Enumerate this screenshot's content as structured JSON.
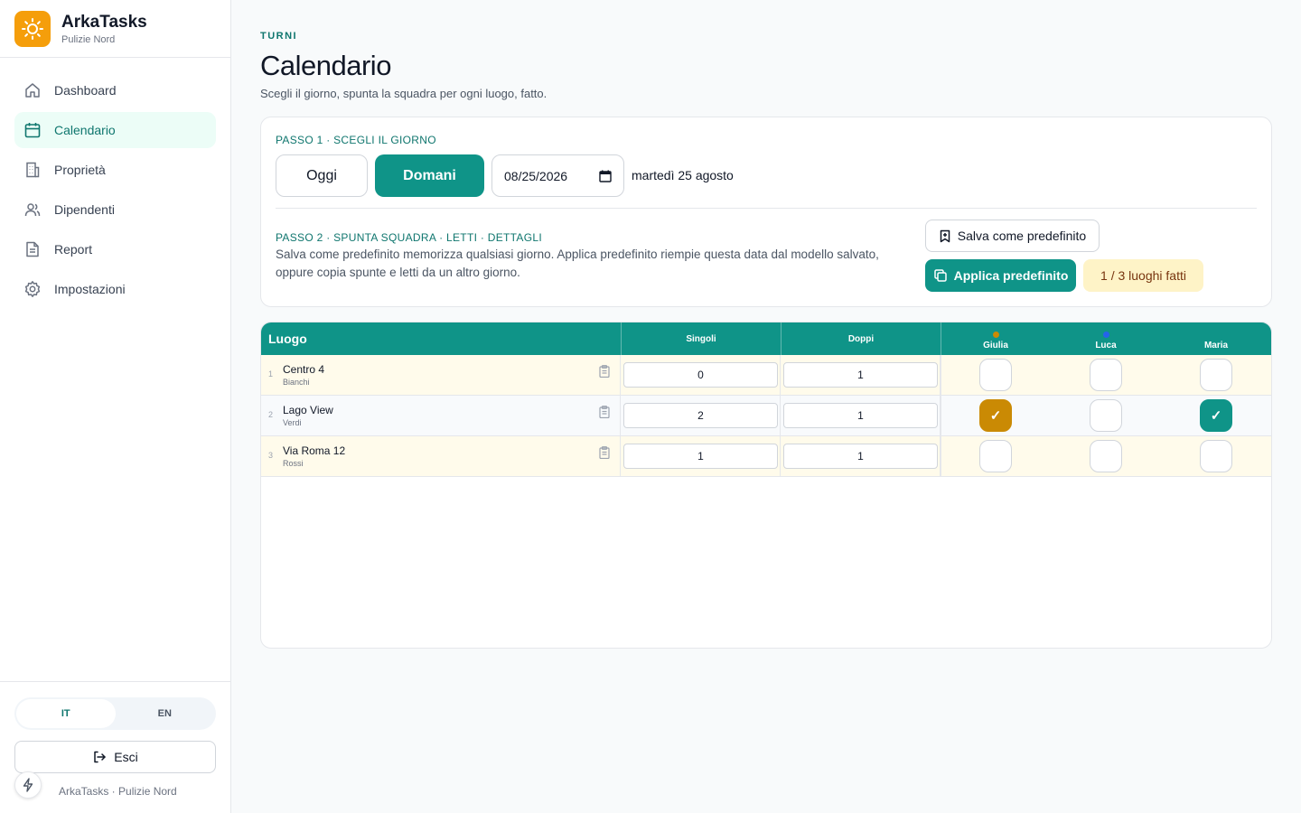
{
  "brand": {
    "name": "ArkaTasks",
    "subtitle": "Pulizie Nord",
    "logo_icon": "sun-icon",
    "logo_color": "#f59e0b"
  },
  "nav": [
    {
      "label": "Dashboard",
      "icon": "home-icon",
      "active": false
    },
    {
      "label": "Calendario",
      "icon": "calendar-icon",
      "active": true
    },
    {
      "label": "Proprietà",
      "icon": "building-icon",
      "active": false
    },
    {
      "label": "Dipendenti",
      "icon": "users-icon",
      "active": false
    },
    {
      "label": "Report",
      "icon": "document-icon",
      "active": false
    },
    {
      "label": "Impostazioni",
      "icon": "gear-icon",
      "active": false
    }
  ],
  "language": {
    "options": [
      "IT",
      "EN"
    ],
    "selected": "IT"
  },
  "logout_label": "Esci",
  "footer": "ArkaTasks · Pulizie Nord",
  "page": {
    "eyebrow": "TURNI",
    "title": "Calendario",
    "description": "Scegli il giorno, spunta la squadra per ogni luogo, fatto."
  },
  "step1": {
    "label": "PASSO 1 · SCEGLI IL GIORNO",
    "today_label": "Oggi",
    "tomorrow_label": "Domani",
    "selected": "Domani",
    "date_value": "08/25/2026",
    "date_text": "martedì 25 agosto"
  },
  "step2": {
    "label": "PASSO 2 · SPUNTA SQUADRA · LETTI · DETTAGLI",
    "description": "Salva come predefinito memorizza qualsiasi giorno. Applica predefinito riempie questa data dal modello salvato, oppure copia spunte e letti da un altro giorno.",
    "save_label": "Salva come predefinito",
    "apply_label": "Applica predefinito",
    "progress": "1 / 3 luoghi fatti"
  },
  "accent": "#0f9488",
  "table": {
    "headers": {
      "luogo": "Luogo",
      "singoli": "Singoli",
      "doppi": "Doppi"
    },
    "people": [
      {
        "name": "Giulia",
        "color": "#ca8a04"
      },
      {
        "name": "Luca",
        "color": "#2563eb"
      },
      {
        "name": "Maria",
        "color": "#0f9488"
      }
    ],
    "rows": [
      {
        "index": "1",
        "name": "Centro 4",
        "owner": "Bianchi",
        "singoli": "0",
        "doppi": "1",
        "checks": [
          false,
          false,
          false
        ]
      },
      {
        "index": "2",
        "name": "Lago View",
        "owner": "Verdi",
        "singoli": "2",
        "doppi": "1",
        "checks": [
          true,
          false,
          true
        ]
      },
      {
        "index": "3",
        "name": "Via Roma 12",
        "owner": "Rossi",
        "singoli": "1",
        "doppi": "1",
        "checks": [
          false,
          false,
          false
        ]
      }
    ],
    "check_mark": "✓"
  }
}
